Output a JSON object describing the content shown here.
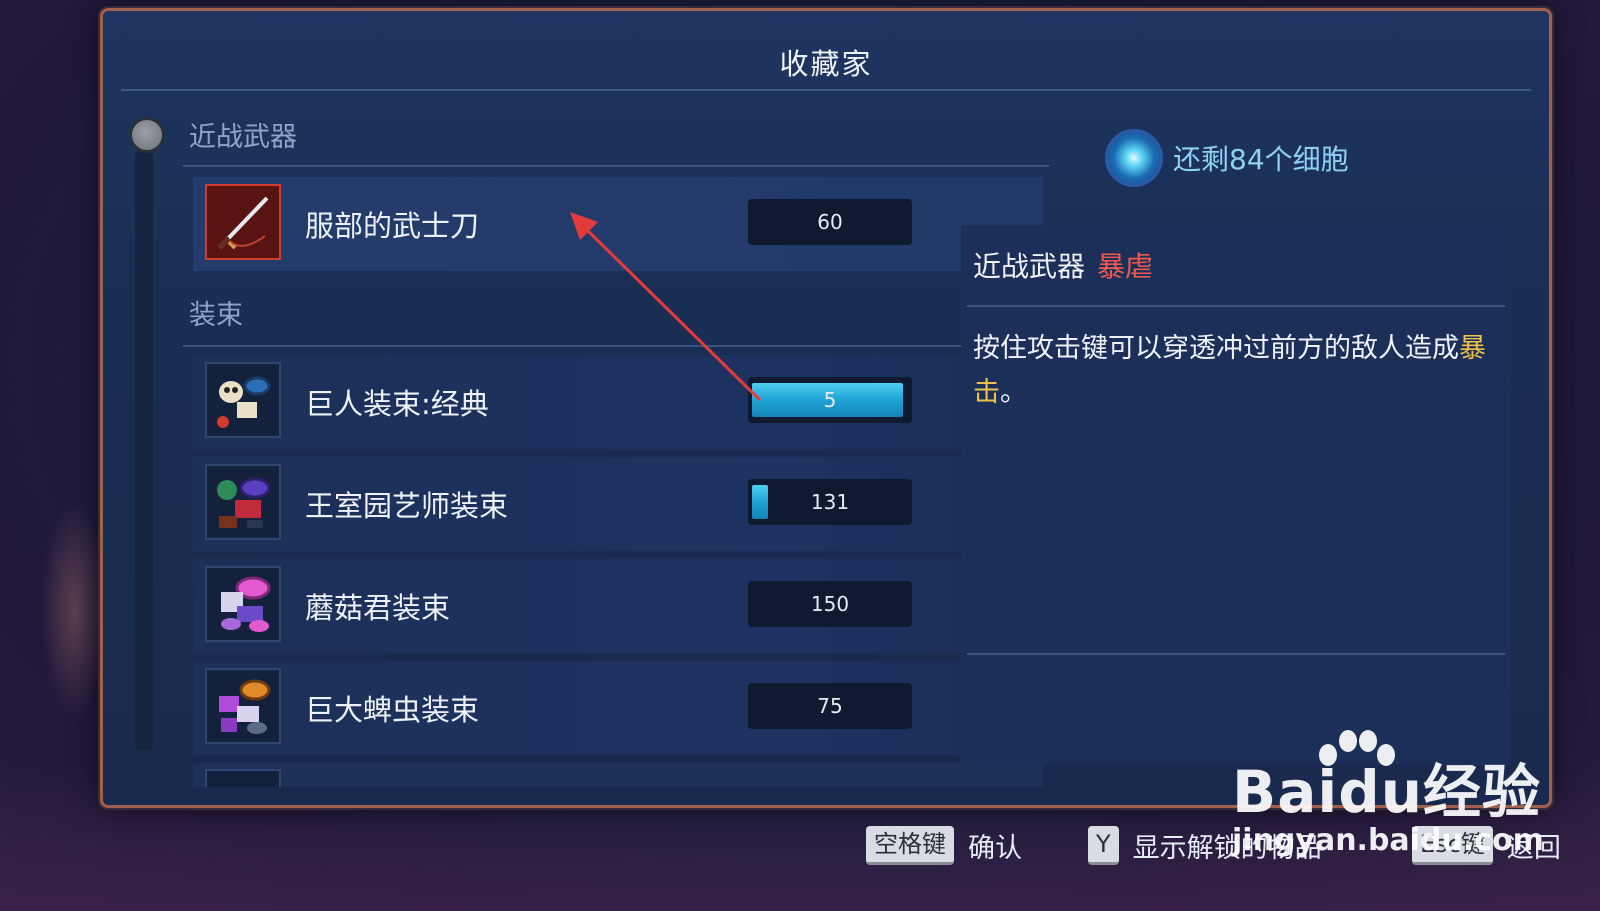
{
  "window": {
    "title": "收藏家"
  },
  "categories": [
    {
      "label": "近战武器",
      "items": [
        {
          "name": "服部的武士刀",
          "cost": "60",
          "progress": 0,
          "selected": true,
          "icon": "katana-icon"
        }
      ]
    },
    {
      "label": "装束",
      "items": [
        {
          "name": "巨人装束:经典",
          "cost": "5",
          "progress": 0.97,
          "selected": false,
          "icon": "giant-outfit-icon"
        },
        {
          "name": "王室园艺师装束",
          "cost": "131",
          "progress": 0.1,
          "selected": false,
          "icon": "gardener-outfit-icon"
        },
        {
          "name": "蘑菇君装束",
          "cost": "150",
          "progress": 0,
          "selected": false,
          "icon": "mushroom-outfit-icon"
        },
        {
          "name": "巨大蜱虫装束",
          "cost": "75",
          "progress": 0,
          "selected": false,
          "icon": "tick-outfit-icon"
        }
      ]
    }
  ],
  "cells": {
    "text": "还剩84个细胞",
    "icon": "cell-icon"
  },
  "detail": {
    "kind": "近战武器",
    "tag": "暴虐",
    "description_main": "按住攻击键可以穿透冲过前方的敌人造成",
    "description_highlight": "暴击",
    "description_end": "。"
  },
  "footer": {
    "actions": [
      {
        "key": "空格键",
        "label": "确认"
      },
      {
        "key": "Y",
        "label": "显示解锁的物品"
      },
      {
        "key": "Esc键",
        "label": "返回"
      }
    ]
  },
  "watermark": {
    "logo": "Baidu经验",
    "url": "jingyan.baidu.com"
  },
  "colors": {
    "panel_border": "#a0604e",
    "selected_border": "#d23b2e",
    "progress_fill": "#1ea4d4",
    "tag_red": "#ee5a4e",
    "highlight_yellow": "#f0c04a",
    "cells_text": "#8fd1f3"
  }
}
